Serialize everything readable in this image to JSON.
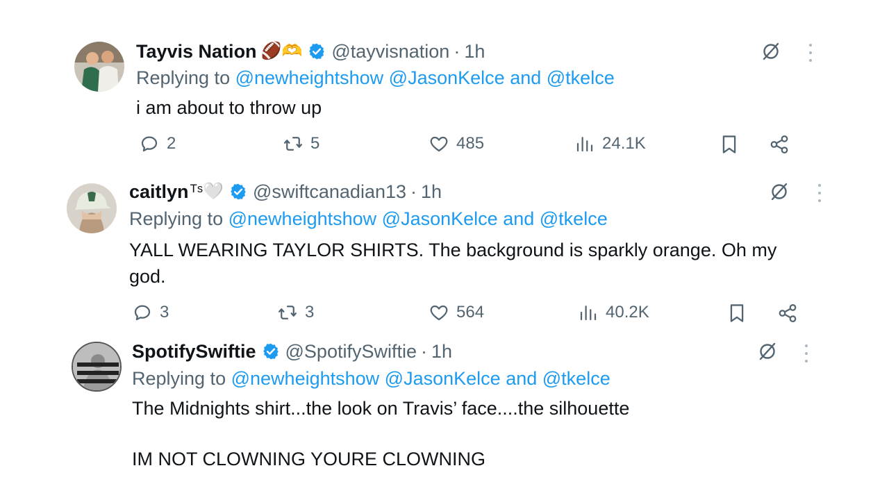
{
  "tweets": [
    {
      "name": "Tayvis Nation",
      "emoji": "🏈🫶",
      "handle": "@tayvisnation",
      "time": "1h",
      "replying_label": "Replying to",
      "mentions": [
        "@newheightshow",
        "@JasonKelce",
        "@tkelce"
      ],
      "and_label": "and",
      "text": "i am about to throw up",
      "replies": "2",
      "retweets": "5",
      "likes": "485",
      "views": "24.1K"
    },
    {
      "name": "caitlyn",
      "emoji": "ᵀˢ🤍",
      "handle": "@swiftcanadian13",
      "time": "1h",
      "replying_label": "Replying to",
      "mentions": [
        "@newheightshow",
        "@JasonKelce",
        "@tkelce"
      ],
      "and_label": "and",
      "text": "YALL WEARING TAYLOR SHIRTS. The background is sparkly orange. Oh my god.",
      "replies": "3",
      "retweets": "3",
      "likes": "564",
      "views": "40.2K"
    },
    {
      "name": "SpotifySwiftie",
      "emoji": "",
      "handle": "@SpotifySwiftie",
      "time": "1h",
      "replying_label": "Replying to",
      "mentions": [
        "@newheightshow",
        "@JasonKelce",
        "@tkelce"
      ],
      "and_label": "and",
      "text_line1": "The Midnights shirt...the look on Travis’ face....the silhouette",
      "text_line2": "IM NOT CLOWNING YOURE CLOWNING"
    }
  ],
  "separator": "·",
  "colors": {
    "accent": "#1d9bf0",
    "muted": "#536471",
    "text": "#0f1419"
  },
  "icons": [
    "verified-badge-icon",
    "grok-icon",
    "more-icon",
    "reply-icon",
    "retweet-icon",
    "like-icon",
    "views-icon",
    "bookmark-icon",
    "share-icon"
  ]
}
